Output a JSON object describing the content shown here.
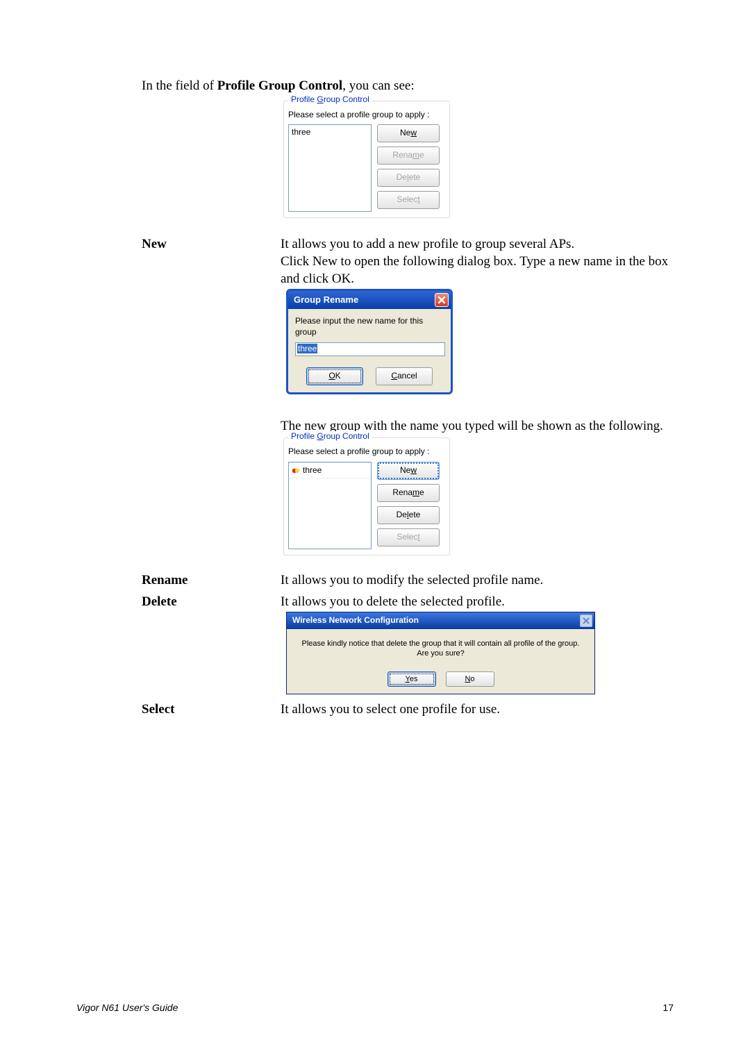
{
  "intro": {
    "prefix": "In the field of ",
    "bold": "Profile Group Control",
    "suffix": ", you can see:"
  },
  "panel1": {
    "legend_parts": [
      "Profile ",
      "G",
      "roup Control"
    ],
    "sublabel": "Please select a profile group to apply :",
    "list": [
      "three"
    ],
    "buttons": {
      "new": {
        "pre": "Ne",
        "u": "w"
      },
      "rename": {
        "pre": "Rena",
        "u": "m",
        "post": "e"
      },
      "delete": {
        "pre": "De",
        "u": "l",
        "post": "ete"
      },
      "select": {
        "pre": "Selec",
        "u": "t"
      }
    }
  },
  "rows": {
    "new": {
      "term": "New",
      "desc1": "It allows you to add a new profile to group several APs.",
      "desc2": "Click New to open the following dialog box. Type a new name in the box and click OK."
    },
    "rename": {
      "term": "Rename",
      "desc": "It allows you to modify the selected profile name."
    },
    "delete": {
      "term": "Delete",
      "desc": "It allows you to delete the selected profile."
    },
    "select": {
      "term": "Select",
      "desc": "It allows you to select one profile for use."
    }
  },
  "dialog_rename": {
    "title": "Group Rename",
    "prompt": "Please input the new name for this group",
    "value": "three",
    "ok": {
      "u": "O",
      "post": "K"
    },
    "cancel": {
      "u": "C",
      "post": "ancel"
    }
  },
  "followup": "The new group with the name you typed will be shown as the following.",
  "panel2": {
    "legend_parts": [
      "Profile ",
      "G",
      "roup Control"
    ],
    "sublabel": "Please select a profile group to apply :",
    "list": [
      "three"
    ],
    "buttons": {
      "new": {
        "pre": "Ne",
        "u": "w"
      },
      "rename": {
        "pre": "Rena",
        "u": "m",
        "post": "e"
      },
      "delete": {
        "pre": "De",
        "u": "l",
        "post": "ete"
      },
      "select": {
        "pre": "Selec",
        "u": "t"
      }
    }
  },
  "dialog_confirm": {
    "title": "Wireless Network Configuration",
    "message": "Please kindly notice that delete the group that it will contain all profile of the group. Are you sure?",
    "yes": {
      "u": "Y",
      "post": "es"
    },
    "no": {
      "u": "N",
      "post": "o"
    }
  },
  "footer": {
    "guide": "Vigor N61 User's Guide",
    "page": "17"
  }
}
